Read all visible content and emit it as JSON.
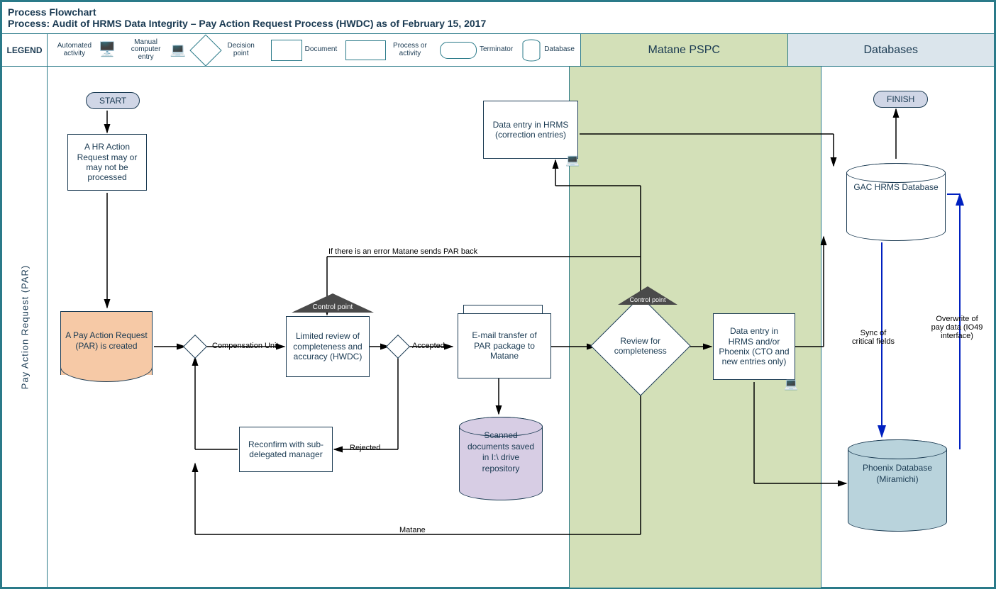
{
  "header": {
    "title1": "Process Flowchart",
    "title2": "Process: Audit of HRMS Data Integrity – Pay Action Request Process (HWDC) as of February 15, 2017"
  },
  "legend": {
    "label": "LEGEND",
    "items": {
      "automated": "Automated activity",
      "manual": "Manual computer entry",
      "decision": "Decision point",
      "document": "Document",
      "process": "Process or activity",
      "terminator": "Terminator",
      "database": "Database"
    }
  },
  "lanes": {
    "swim": "Pay Action Request (PAR)",
    "matane": "Matane PSPC",
    "db": "Databases"
  },
  "nodes": {
    "start": "START",
    "finish": "FINISH",
    "hr_action": "A HR Action Request may or may not be processed",
    "par_created": "A Pay Action Request (PAR) is created",
    "comp_unit": "Compensation Unit",
    "cp1": "Control point",
    "limited_review": "Limited review of completeness and accuracy (HWDC)",
    "accepted": "Accepted",
    "rejected": "Rejected",
    "reconfirm": "Reconfirm with sub-delegated manager",
    "email_transfer": "E-mail transfer of PAR package to Matane",
    "scanned": "Scanned documents saved in I:\\ drive repository",
    "data_entry_hrms": "Data entry in HRMS (correction entries)",
    "cp2": "Control point",
    "review_complete": "Review for completeness",
    "data_entry_phoenix": "Data entry in HRMS and/or Phoenix (CTO and new entries only)",
    "gac_db": "GAC HRMS Database",
    "phoenix_db": "Phoenix Database (Miramichi)"
  },
  "edges": {
    "error_back": "If there is an error Matane sends PAR back",
    "matane": "Matane",
    "sync": "Sync of critical fields",
    "overwrite": "Overwrite of pay data (IO49 interface)"
  }
}
